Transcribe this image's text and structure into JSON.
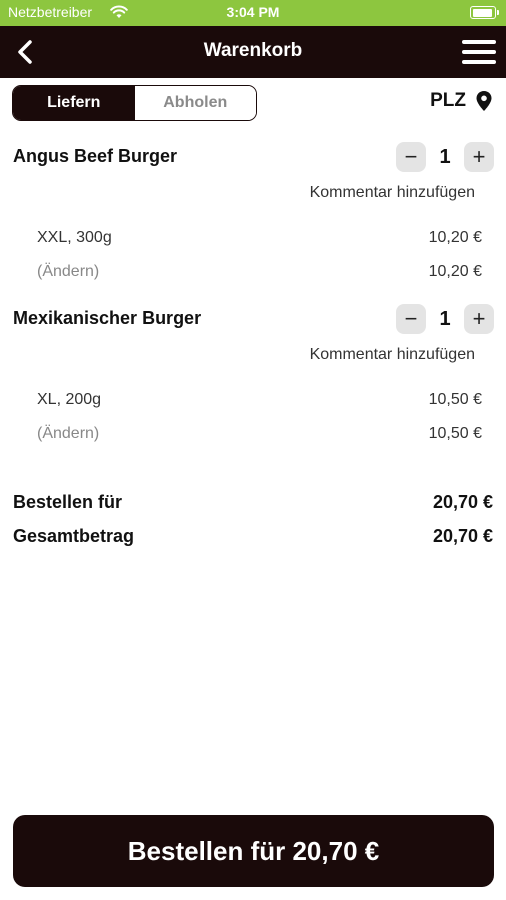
{
  "status_bar": {
    "carrier": "Netzbetreiber",
    "time": "3:04 PM"
  },
  "header": {
    "title": "Warenkorb"
  },
  "tabs": [
    {
      "label": "Liefern",
      "active": true
    },
    {
      "label": "Abholen",
      "active": false
    }
  ],
  "plz": {
    "label": "PLZ"
  },
  "items": [
    {
      "name": "Angus Beef Burger",
      "quantity": "1",
      "comment_link": "Kommentar hinzufügen",
      "option_label": "XXL, 300g",
      "option_price": "10,20 €",
      "change_label": "(Ändern)",
      "change_price": "10,20 €"
    },
    {
      "name": "Mexikanischer Burger",
      "quantity": "1",
      "comment_link": "Kommentar hinzufügen",
      "option_label": "XL, 200g",
      "option_price": "10,50 €",
      "change_label": "(Ändern)",
      "change_price": "10,50 €"
    }
  ],
  "totals": {
    "order_label": "Bestellen für",
    "order_value": "20,70 €",
    "total_label": "Gesamtbetrag",
    "total_value": "20,70 €"
  },
  "checkout": {
    "label": "Bestellen für 20,70 €"
  },
  "colors": {
    "status_green": "#8dc63f",
    "dark": "#1a0a0a",
    "stepper_bg": "#e4e4e4"
  },
  "icons": [
    "wifi-icon",
    "battery-icon",
    "back-arrow-icon",
    "hamburger-menu-icon",
    "location-pin-icon",
    "minus-icon",
    "plus-icon"
  ]
}
